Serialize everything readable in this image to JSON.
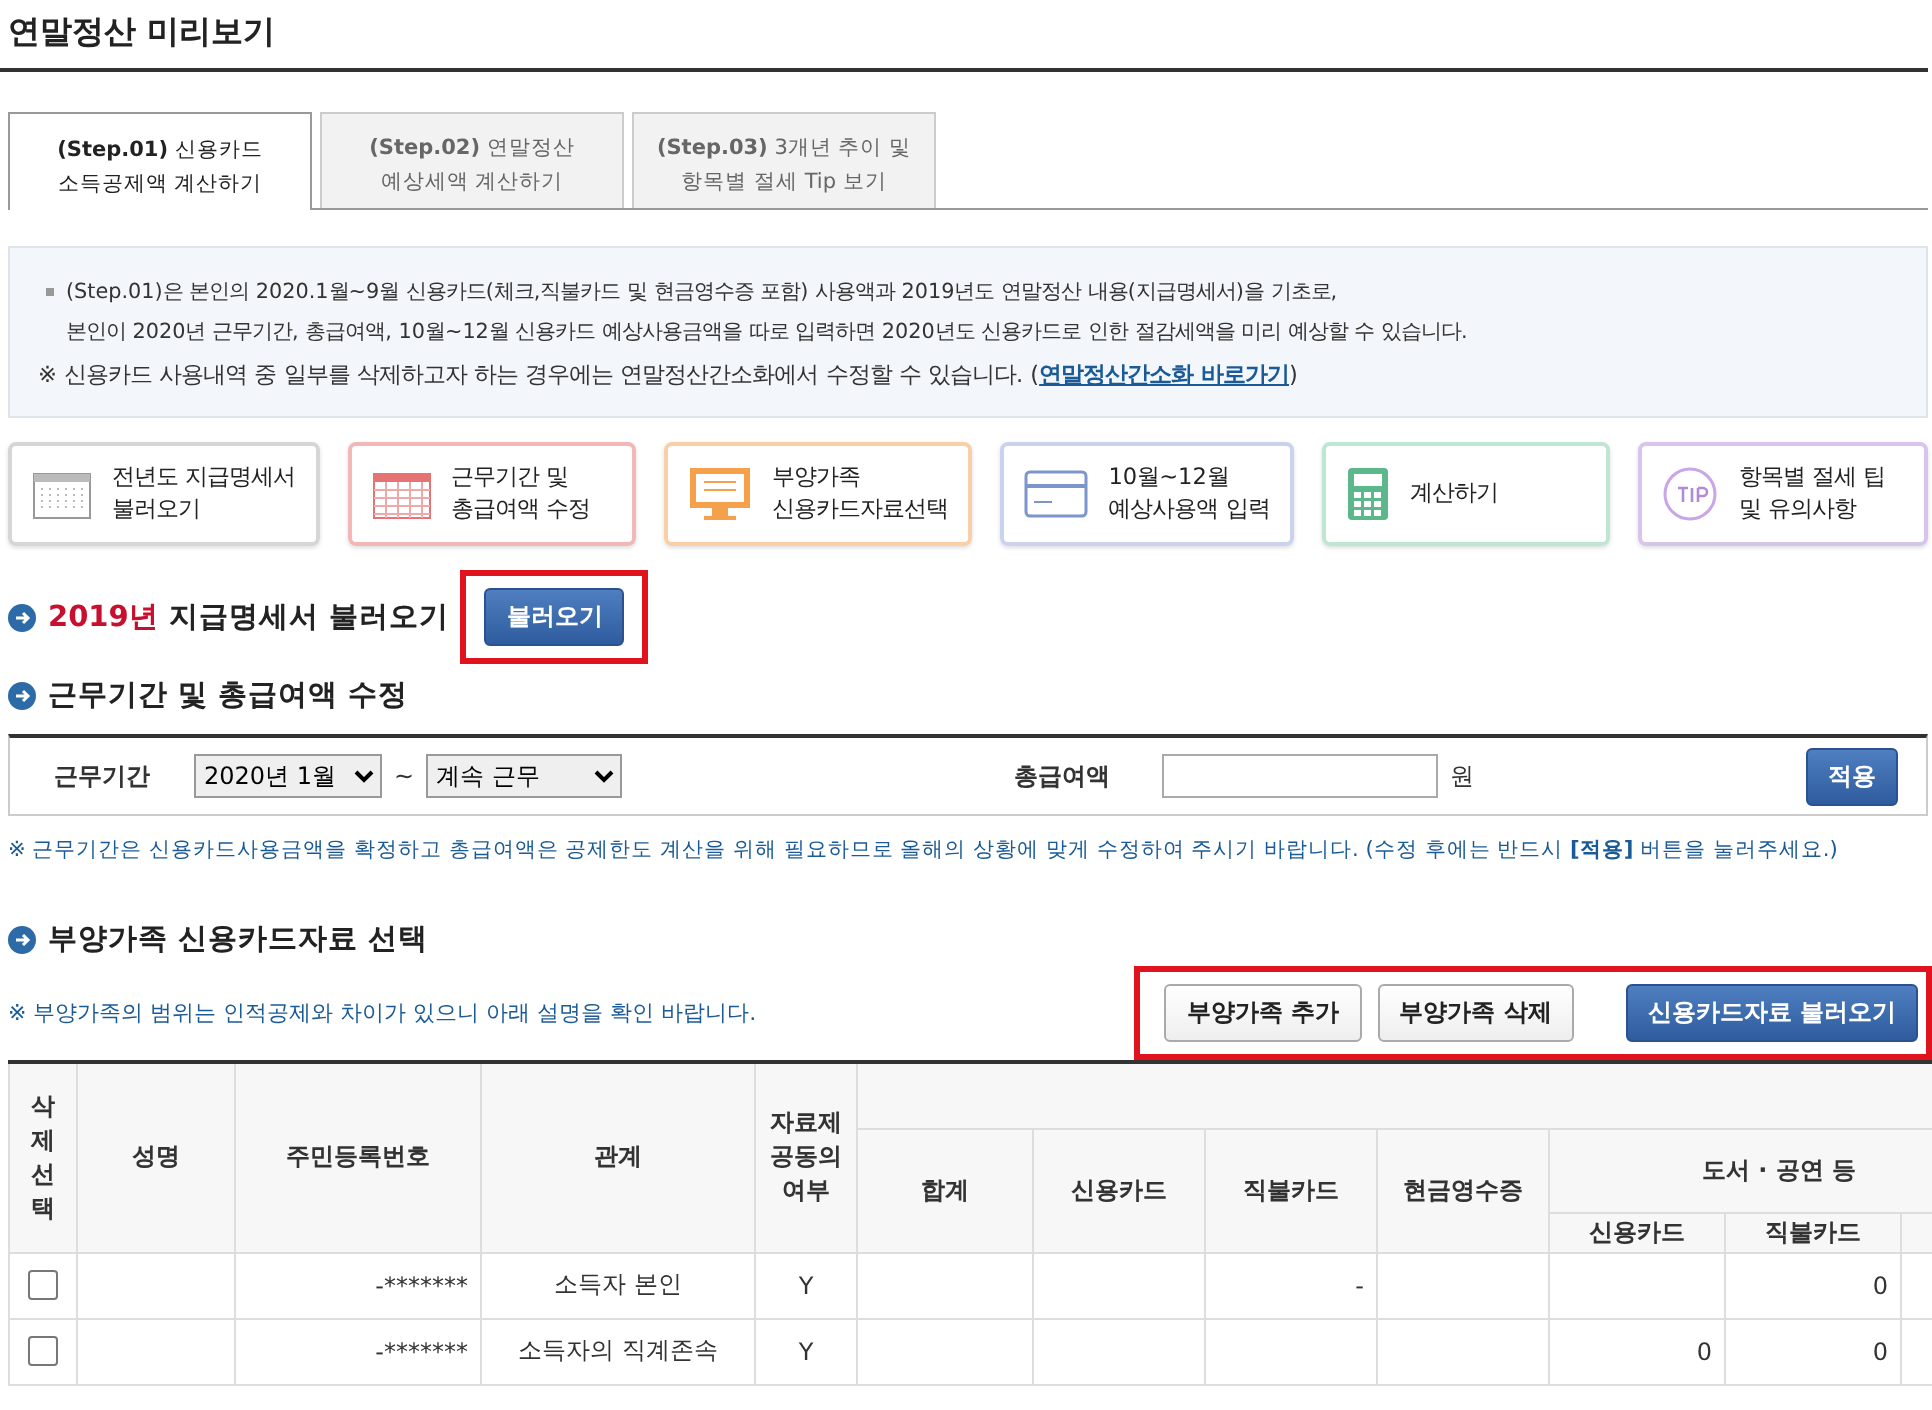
{
  "page_title": "연말정산 미리보기",
  "tabs": [
    {
      "step": "(Step.01)",
      "title": "신용카드",
      "line2": "소득공제액 계산하기",
      "selected": true
    },
    {
      "step": "(Step.02)",
      "title": "연말정산",
      "line2": "예상세액 계산하기",
      "selected": false
    },
    {
      "step": "(Step.03)",
      "title": "3개년 추이 및",
      "line2": "항목별 절세 Tip 보기",
      "selected": false
    }
  ],
  "info": {
    "bullet": [
      "(Step.01)은 본인의 2020.1월~9월 신용카드(체크,직불카드 및 현금영수증 포함) 사용액과 2019년도 연말정산 내용(지급명세서)을 기초로,",
      "본인이 2020년 근무기간, 총급여액, 10월~12월 신용카드 예상사용금액을 따로 입력하면 2020년도 신용카드로 인한 절감세액을 미리 예상할 수 있습니다."
    ],
    "note": "※ 신용카드 사용내역 중 일부를 삭제하고자 하는 경우에는 연말정산간소화에서 수정할 수 있습니다. (",
    "link": "연말정산간소화 바로가기",
    "note_end": ")"
  },
  "steps": [
    {
      "kind": "calendar",
      "label": [
        "전년도 지급명세서",
        "불러오기"
      ],
      "color": "#d6d6d6"
    },
    {
      "kind": "grid",
      "label": [
        "근무기간 및",
        "총급여액 수정"
      ],
      "color": "#f2b8b8"
    },
    {
      "kind": "monitor",
      "label": [
        "부양가족",
        "신용카드자료선택"
      ],
      "color": "#f8cfa6"
    },
    {
      "kind": "card",
      "label": [
        "10월~12월",
        "예상사용액 입력"
      ],
      "color": "#c9d3ee"
    },
    {
      "kind": "calculator",
      "label": [
        "계산하기"
      ],
      "color": "#bfe6d2"
    },
    {
      "kind": "tip",
      "label": [
        "항목별 절세 팁",
        "및 유의사항"
      ],
      "color": "#d8c4ec"
    }
  ],
  "section1": {
    "year": "2019년",
    "title": "지급명세서 불러오기",
    "button": "불러오기"
  },
  "section2": {
    "title": "근무기간 및 총급여액 수정",
    "period_label": "근무기간",
    "start": "2020년 1월",
    "tilde": "~",
    "end": "계속 근무",
    "salary_label": "총급여액",
    "unit": "원",
    "apply": "적용",
    "note": "※ 근무기간은 신용카드사용금액을 확정하고 총급여액은 공제한도 계산을 위해 필요하므로 올해의 상황에 맞게 수정하여 주시기 바랍니다. (수정 후에는 반드시 **[적용]** 버튼을 눌러주세요.)"
  },
  "section3": {
    "title": "부양가족 신용카드자료 선택",
    "note": "※ 부양가족의 범위는 인적공제와 차이가 있으니 아래 설명을 확인 바랍니다.",
    "buttons": [
      "부양가족 추가",
      "부양가족 삭제"
    ],
    "load_button": "신용카드자료 불러오기"
  },
  "table": {
    "fixed_columns": [
      "삭제선택",
      "성명",
      "주민등록번호",
      "관계",
      "자료제공동의여부"
    ],
    "amount_columns": [
      "합계",
      "신용카드",
      "직불카드",
      "현금영수증"
    ],
    "group": "도서 · 공연 등",
    "group_columns": [
      "신용카드",
      "직불카드"
    ],
    "rows": [
      {
        "checked": false,
        "id": "-*******",
        "relation": "소득자 본인",
        "consent": "Y",
        "cells": [
          "",
          "",
          "-",
          "",
          "",
          "0"
        ]
      },
      {
        "checked": false,
        "id": "-*******",
        "relation": "소득자의 직계존속",
        "consent": "Y",
        "cells": [
          "",
          "",
          "",
          "",
          "0",
          "0"
        ]
      }
    ]
  }
}
